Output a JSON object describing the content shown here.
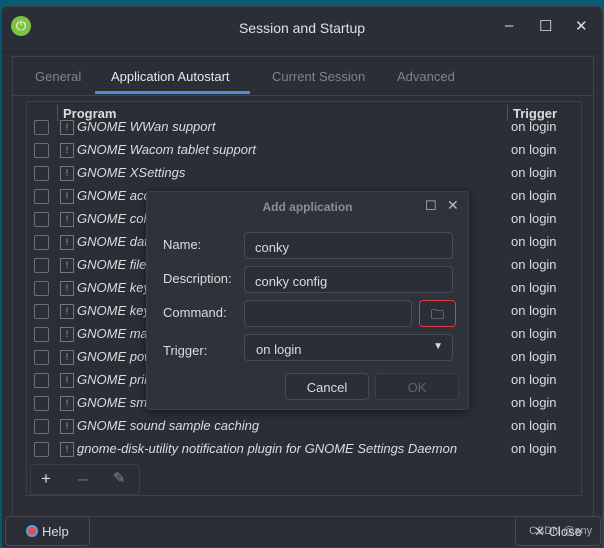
{
  "window": {
    "title": "Session and Startup",
    "minimize": "–",
    "maximize": "☐",
    "close": "✕"
  },
  "tabs": [
    {
      "label": "General"
    },
    {
      "label": "Application Autostart"
    },
    {
      "label": "Current Session"
    },
    {
      "label": "Advanced"
    }
  ],
  "list": {
    "headers": {
      "program": "Program",
      "trigger": "Trigger"
    },
    "rows": [
      {
        "name": "GNOME WWan support",
        "trigger": "on login"
      },
      {
        "name": "GNOME Wacom tablet support",
        "trigger": "on login"
      },
      {
        "name": "GNOME XSettings",
        "trigger": "on login"
      },
      {
        "name": "GNOME acce",
        "trigger": "on login"
      },
      {
        "name": "GNOME colo",
        "trigger": "on login"
      },
      {
        "name": "GNOME date",
        "trigger": "on login"
      },
      {
        "name": "GNOME file s",
        "trigger": "on login"
      },
      {
        "name": "GNOME keyb",
        "trigger": "on login"
      },
      {
        "name": "GNOME keyb",
        "trigger": "on login"
      },
      {
        "name": "GNOME mai",
        "trigger": "on login"
      },
      {
        "name": "GNOME pow",
        "trigger": "on login"
      },
      {
        "name": "GNOME prin",
        "trigger": "on login"
      },
      {
        "name": "GNOME sma",
        "trigger": "on login"
      },
      {
        "name": "GNOME sound sample caching",
        "trigger": "on login"
      },
      {
        "name": "gnome-disk-utility notification plugin for GNOME Settings Daemon",
        "trigger": "on login"
      }
    ]
  },
  "toolbar": {
    "add": "+",
    "remove": "–",
    "edit": "✎"
  },
  "footer": {
    "help": "Help",
    "close": "✕ Close",
    "watermark": "CSDN @any"
  },
  "dialog": {
    "title": "Add application",
    "name_label": "Name:",
    "name_value": "conky",
    "desc_label": "Description:",
    "desc_value": "conky config",
    "command_label": "Command:",
    "command_value": "",
    "trigger_label": "Trigger:",
    "trigger_value": "on login",
    "cancel": "Cancel",
    "ok": "OK"
  },
  "colors": {
    "accent": "#4a90d9",
    "highlight_box": "#e0393e",
    "app_icon": "#7cc243"
  }
}
